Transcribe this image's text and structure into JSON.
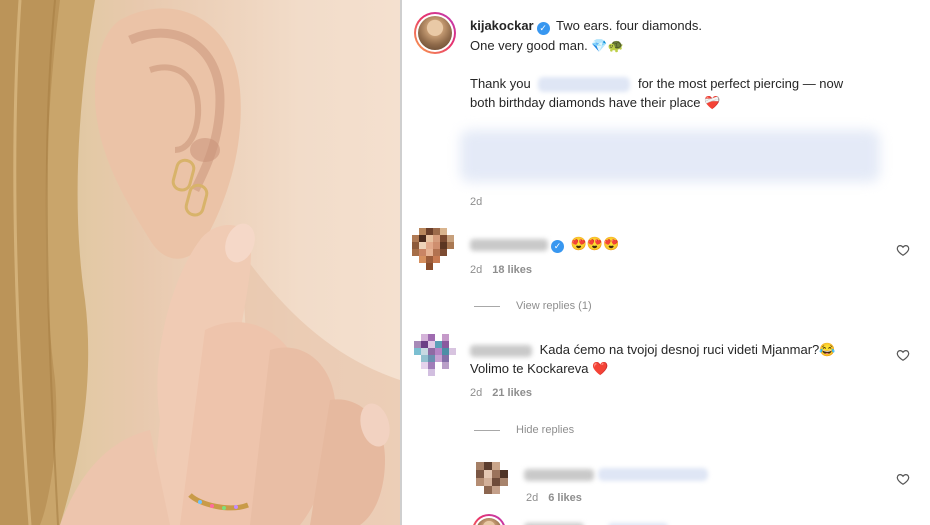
{
  "post": {
    "username": "kijakockar",
    "caption_line1": "Two ears. four diamonds.",
    "caption_line2": "One very good man.",
    "caption_line2_emoji": "💎🐢",
    "caption_line3_pre": "Thank you",
    "caption_line3_post": "for the most perfect piercing — now",
    "caption_line4": "both birthday diamonds have their place",
    "caption_line4_emoji": "❤️‍🩹",
    "time": "2d"
  },
  "comments": [
    {
      "text": "",
      "emoji": "😍😍😍",
      "time": "2d",
      "likes": "18 likes",
      "replies_toggle": "View replies (1)",
      "verified": true
    },
    {
      "text_line1": "Kada ćemo na tvojoj desnoj ruci videti Mjanmar?",
      "emoji_line1": "😂",
      "text_line2": "Volimo te Kockareva",
      "emoji_line2": "❤️",
      "time": "2d",
      "likes": "21 likes",
      "replies_toggle": "Hide replies"
    }
  ],
  "reply": {
    "time": "2d",
    "likes": "6 likes"
  },
  "icons": {
    "verified": "verified-badge-icon",
    "like": "heart-outline-icon"
  },
  "colors": {
    "verified": "#3897f0",
    "meta": "#8e8e8e",
    "text": "#262626",
    "heart_emoji": "#e0245e"
  }
}
